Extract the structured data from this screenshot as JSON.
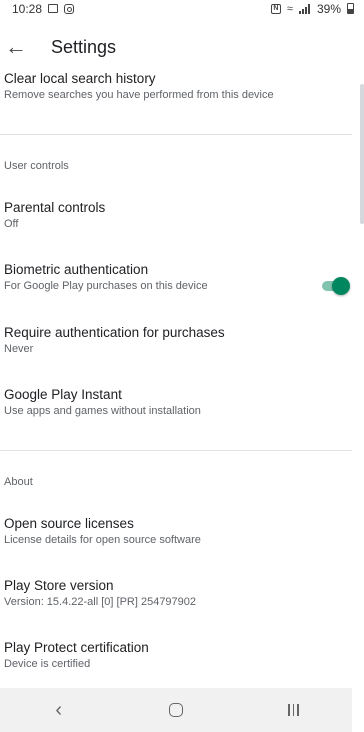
{
  "status_bar": {
    "time": "10:28",
    "battery": "39%"
  },
  "app_bar": {
    "title": "Settings",
    "back_icon": "arrow-left-icon"
  },
  "sections": {
    "clear_history": {
      "title": "Clear local search history",
      "summary": "Remove searches you have performed from this device"
    },
    "user_controls_label": "User controls",
    "parental": {
      "title": "Parental controls",
      "summary": "Off"
    },
    "biometric": {
      "title": "Biometric authentication",
      "summary": "For Google Play purchases on this device",
      "enabled": true
    },
    "require_auth": {
      "title": "Require authentication for purchases",
      "summary": "Never"
    },
    "instant": {
      "title": "Google Play Instant",
      "summary": "Use apps and games without installation"
    },
    "about_label": "About",
    "licenses": {
      "title": "Open source licenses",
      "summary": "License details for open source software"
    },
    "version": {
      "title": "Play Store version",
      "summary": "Version: 15.4.22-all [0] [PR] 254797902"
    },
    "protect": {
      "title": "Play Protect certification",
      "summary": "Device is certified"
    }
  },
  "colors": {
    "accent": "#01875f",
    "text": "#202124",
    "secondary": "#5f6368",
    "nav_bg": "#f1f1f1"
  },
  "nav_bar": {
    "back_icon": "chevron-left-icon",
    "home_icon": "home-icon",
    "recents_icon": "recents-icon"
  }
}
